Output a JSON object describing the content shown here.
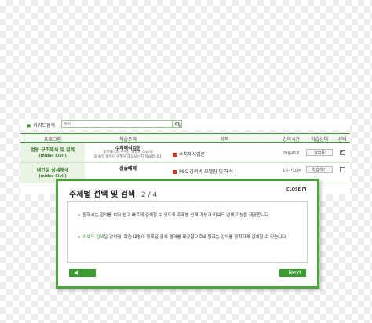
{
  "search": {
    "label": "키워드검색",
    "value": "해석"
  },
  "table": {
    "headers": [
      "프로그램",
      "학습주제",
      "제목",
      "강의시간",
      "학습상태",
      "선택"
    ],
    "rows": [
      {
        "course_title": "범용 구조해석 및 설계",
        "course_sub": "(midas Civil)",
        "topic_title": "수치해석입문",
        "topic_desc_1": "구조해석의 수계산 과정과 Civil의",
        "topic_desc_2": "입·출력 항목이 어떻게 대응되는지 학습합니다.",
        "chapter": "수치해석입문",
        "time": "28분45초",
        "study_label": "학습중",
        "checked": true
      },
      {
        "course_title": "네건설 상세해석",
        "course_sub": "(midas Civil)",
        "topic_title": "실습예제",
        "topic_desc_1": "",
        "topic_desc_2": "",
        "chapter": "PSC 강적박 모델링 및 해석 I",
        "time": "1시간10분",
        "study_label": "학습하기",
        "checked": false
      }
    ]
  },
  "modal": {
    "title": "주제별 선택 및 검색",
    "page": "2 / 4",
    "close_label": "CLOSE",
    "line1": "원하시는 강의를 보다 쉽고 빠르게 검색할 수 있도록 주제별 선택 기능과 키워드 검색 기능을 제공합니다.",
    "line2_keyword": "키워드 검색",
    "line2_rest": "은 강의명, 학습 내용이 등록된 검색 결과를 제공함으로써 원하는 강의를 정확하게 검색할 수 있습니다.",
    "prev_label": "Prev",
    "next_label": "Next"
  }
}
